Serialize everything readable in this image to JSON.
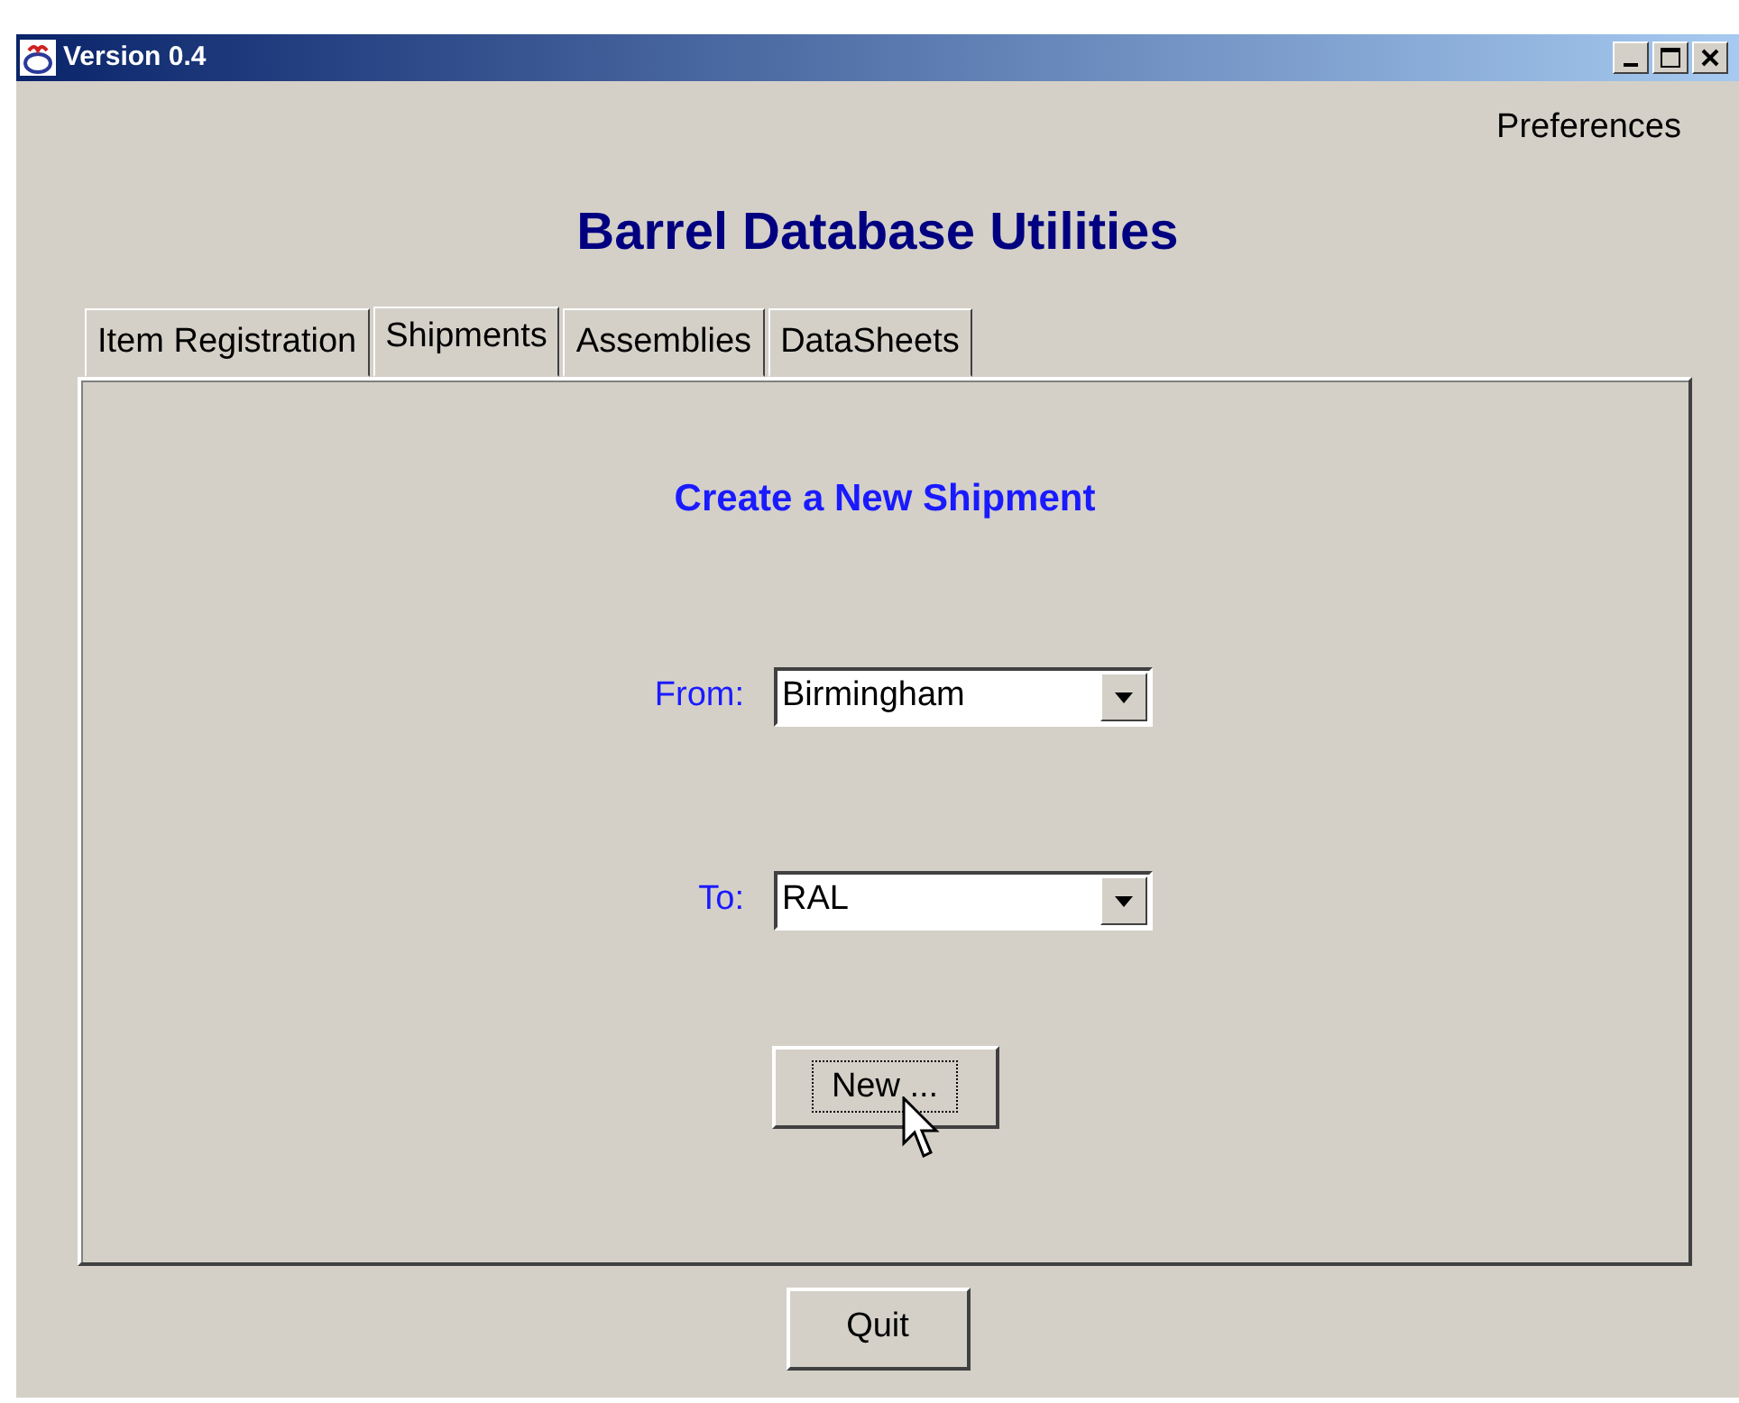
{
  "window": {
    "title": "Version 0.4"
  },
  "menu": {
    "label": "Preferences"
  },
  "heading": "Barrel Database Utilities",
  "tabs": [
    {
      "label": "Item Registration",
      "selected": false
    },
    {
      "label": "Shipments",
      "selected": true
    },
    {
      "label": "Assemblies",
      "selected": false
    },
    {
      "label": "DataSheets",
      "selected": false
    }
  ],
  "panel": {
    "title": "Create a New Shipment",
    "fields": [
      {
        "label": "From:",
        "value": "Birmingham"
      },
      {
        "label": "To:",
        "value": "RAL"
      }
    ],
    "button": "New ..."
  },
  "buttons": [
    "Quit"
  ]
}
